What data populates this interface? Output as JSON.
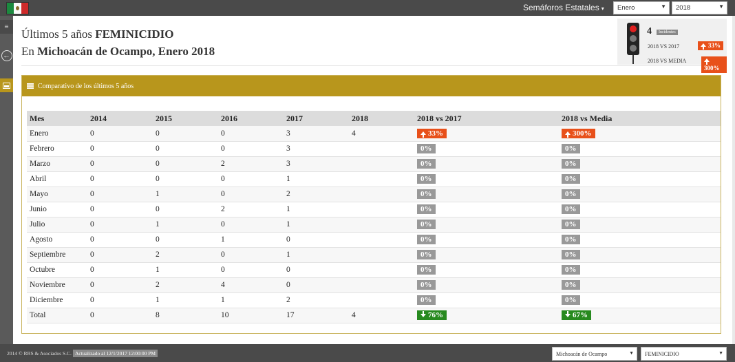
{
  "header": {
    "menu_label": "Semáforos Estatales",
    "month_select": "Enero",
    "year_select": "2018"
  },
  "page": {
    "title_prefix": "Últimos 5 años",
    "title_bold": "FEMINICIDIO",
    "subtitle_prefix": "En",
    "subtitle_bold": "Michoacán de Ocampo, Enero 2018"
  },
  "summary": {
    "count": "4",
    "count_label": "Incidentes",
    "vs_prev_label": "2018 VS 2017",
    "vs_prev_value": "33%",
    "vs_avg_label": "2018 VS MEDIA",
    "vs_avg_value": "300%",
    "colors": {
      "up": "#e8501a",
      "light_active": "#e02020"
    }
  },
  "panel": {
    "title": "Comparativo de los últimos 5 años"
  },
  "table": {
    "columns": [
      "Mes",
      "2014",
      "2015",
      "2016",
      "2017",
      "2018",
      "2018 vs 2017",
      "2018 vs Media"
    ],
    "rows": [
      {
        "mes": "Enero",
        "v2014": "0",
        "v2015": "0",
        "v2016": "0",
        "v2017": "3",
        "v2018": "4",
        "vs2017": "33%",
        "vs2017_dir": "up",
        "vsmedia": "300%",
        "vsmedia_dir": "up"
      },
      {
        "mes": "Febrero",
        "v2014": "0",
        "v2015": "0",
        "v2016": "0",
        "v2017": "3",
        "v2018": "",
        "vs2017": "0%",
        "vs2017_dir": "zero",
        "vsmedia": "0%",
        "vsmedia_dir": "zero"
      },
      {
        "mes": "Marzo",
        "v2014": "0",
        "v2015": "0",
        "v2016": "2",
        "v2017": "3",
        "v2018": "",
        "vs2017": "0%",
        "vs2017_dir": "zero",
        "vsmedia": "0%",
        "vsmedia_dir": "zero"
      },
      {
        "mes": "Abril",
        "v2014": "0",
        "v2015": "0",
        "v2016": "0",
        "v2017": "1",
        "v2018": "",
        "vs2017": "0%",
        "vs2017_dir": "zero",
        "vsmedia": "0%",
        "vsmedia_dir": "zero"
      },
      {
        "mes": "Mayo",
        "v2014": "0",
        "v2015": "1",
        "v2016": "0",
        "v2017": "2",
        "v2018": "",
        "vs2017": "0%",
        "vs2017_dir": "zero",
        "vsmedia": "0%",
        "vsmedia_dir": "zero"
      },
      {
        "mes": "Junio",
        "v2014": "0",
        "v2015": "0",
        "v2016": "2",
        "v2017": "1",
        "v2018": "",
        "vs2017": "0%",
        "vs2017_dir": "zero",
        "vsmedia": "0%",
        "vsmedia_dir": "zero"
      },
      {
        "mes": "Julio",
        "v2014": "0",
        "v2015": "1",
        "v2016": "0",
        "v2017": "1",
        "v2018": "",
        "vs2017": "0%",
        "vs2017_dir": "zero",
        "vsmedia": "0%",
        "vsmedia_dir": "zero"
      },
      {
        "mes": "Agosto",
        "v2014": "0",
        "v2015": "0",
        "v2016": "1",
        "v2017": "0",
        "v2018": "",
        "vs2017": "0%",
        "vs2017_dir": "zero",
        "vsmedia": "0%",
        "vsmedia_dir": "zero"
      },
      {
        "mes": "Septiembre",
        "v2014": "0",
        "v2015": "2",
        "v2016": "0",
        "v2017": "1",
        "v2018": "",
        "vs2017": "0%",
        "vs2017_dir": "zero",
        "vsmedia": "0%",
        "vsmedia_dir": "zero"
      },
      {
        "mes": "Octubre",
        "v2014": "0",
        "v2015": "1",
        "v2016": "0",
        "v2017": "0",
        "v2018": "",
        "vs2017": "0%",
        "vs2017_dir": "zero",
        "vsmedia": "0%",
        "vsmedia_dir": "zero"
      },
      {
        "mes": "Noviembre",
        "v2014": "0",
        "v2015": "2",
        "v2016": "4",
        "v2017": "0",
        "v2018": "",
        "vs2017": "0%",
        "vs2017_dir": "zero",
        "vsmedia": "0%",
        "vsmedia_dir": "zero"
      },
      {
        "mes": "Diciembre",
        "v2014": "0",
        "v2015": "1",
        "v2016": "1",
        "v2017": "2",
        "v2018": "",
        "vs2017": "0%",
        "vs2017_dir": "zero",
        "vsmedia": "0%",
        "vsmedia_dir": "zero"
      },
      {
        "mes": "Total",
        "v2014": "0",
        "v2015": "8",
        "v2016": "10",
        "v2017": "17",
        "v2018": "4",
        "vs2017": "76%",
        "vs2017_dir": "down",
        "vsmedia": "67%",
        "vsmedia_dir": "down"
      }
    ]
  },
  "footer": {
    "copyright": "2014 © RRS & Asociados S.C.",
    "updated": "Actualizado al 12/1/2017 12:00:00 PM",
    "state_select": "Michoacán de Ocampo",
    "crime_select": "FEMINICIDIO"
  }
}
